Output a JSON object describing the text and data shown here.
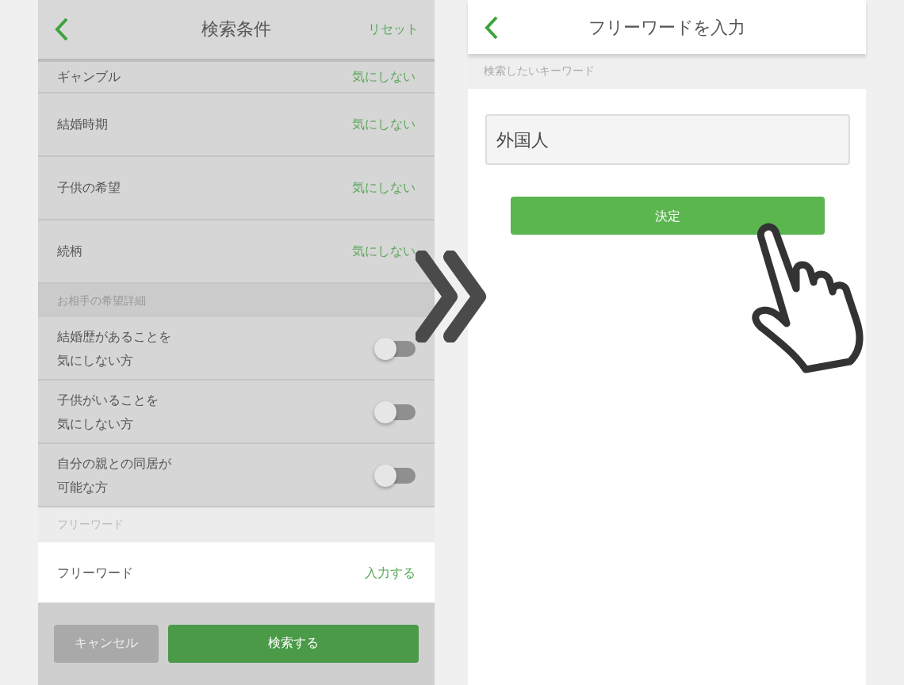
{
  "left_screen": {
    "header": {
      "title": "検索条件",
      "action": "リセット"
    },
    "rows": [
      {
        "label": "ギャンブル",
        "value": "気にしない"
      },
      {
        "label": "結婚時期",
        "value": "気にしない"
      },
      {
        "label": "子供の希望",
        "value": "気にしない"
      },
      {
        "label": "続柄",
        "value": "気にしない"
      }
    ],
    "detail_section": {
      "title": "お相手の希望詳細",
      "toggles": [
        {
          "label_lines": [
            "結婚歴があることを",
            "気にしない方"
          ],
          "on": false
        },
        {
          "label_lines": [
            "子供がいることを",
            "気にしない方"
          ],
          "on": false
        },
        {
          "label_lines": [
            "自分の親との同居が",
            "可能な方"
          ],
          "on": false
        }
      ]
    },
    "freeword_section": {
      "title": "フリーワード",
      "row": {
        "label": "フリーワード",
        "value": "入力する"
      }
    },
    "buttons": [
      {
        "label": "キャンセル",
        "disabled": true
      },
      {
        "label": "検索する",
        "disabled": false
      }
    ]
  },
  "right_screen": {
    "header": {
      "title": "フリーワードを入力"
    },
    "section_title": "検索したいキーワード",
    "keyword_field": {
      "value": "外国人"
    },
    "submit_button": {
      "label": "決定"
    }
  }
}
